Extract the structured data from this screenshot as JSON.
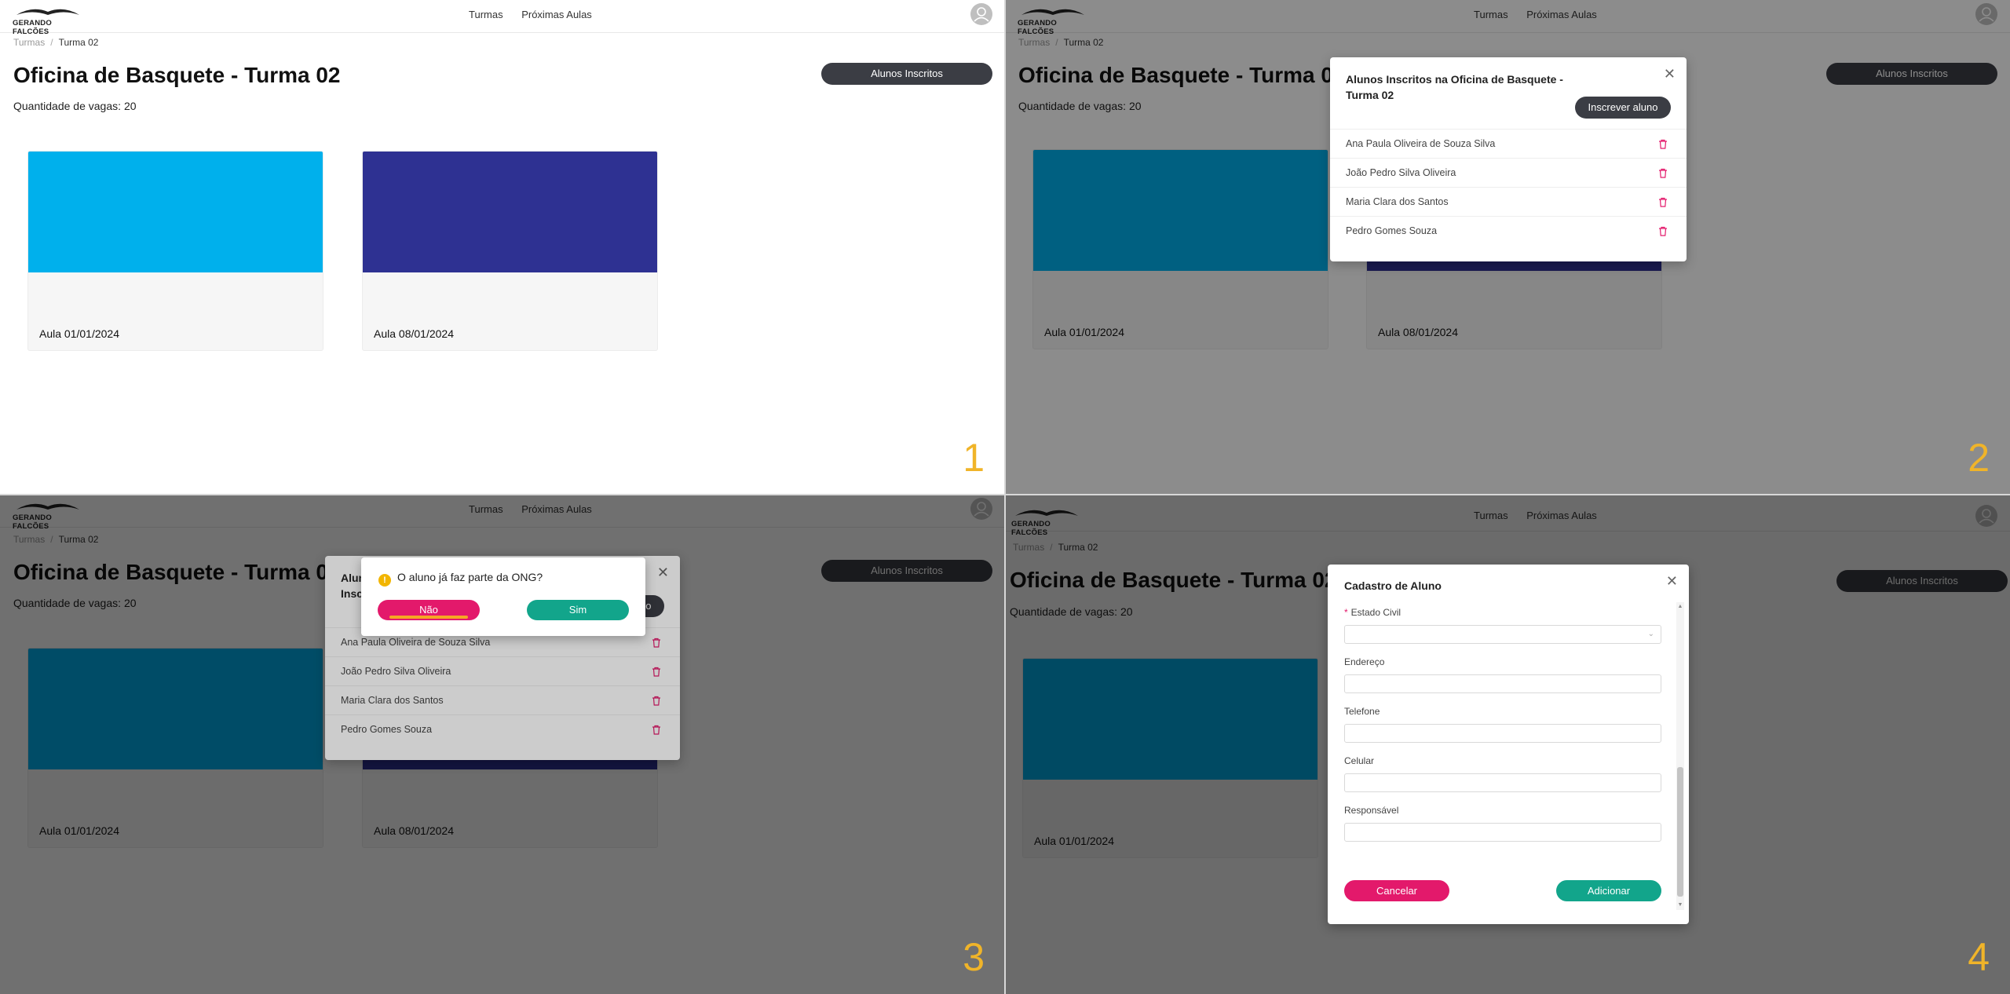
{
  "logo": {
    "text": "GERANDO FALCÕES"
  },
  "nav": {
    "items": [
      "Turmas",
      "Próximas Aulas"
    ]
  },
  "breadcrumb": {
    "root": "Turmas",
    "separator": "/",
    "current": "Turma 02"
  },
  "page": {
    "title": "Oficina de Basquete - Turma 02",
    "vagas_label": "Quantidade de vagas:",
    "vagas_value": "20"
  },
  "alunos_button": "Alunos Inscritos",
  "cards": [
    {
      "label": "Aula 01/01/2024",
      "color": "#00b0ec"
    },
    {
      "label": "Aula 08/01/2024",
      "color": "#2e3192"
    }
  ],
  "students_modal": {
    "title": "Alunos Inscritos na Oficina de Basquete - Turma 02",
    "title_partial": "Alunos Inscritos na Oficina de Basquete - Turma 02",
    "enroll_button": "Inscrever aluno",
    "students": [
      "Ana Paula Oliveira de Souza Silva",
      "João Pedro Silva Oliveira",
      "Maria Clara dos Santos",
      "Pedro Gomes Souza"
    ]
  },
  "confirm_dialog": {
    "question": "O aluno já faz parte da ONG?",
    "no": "Não",
    "yes": "Sim"
  },
  "register_modal": {
    "title": "Cadastro de Aluno",
    "fields": [
      "Estado Civil",
      "Endereço",
      "Telefone",
      "Celular",
      "Responsável"
    ],
    "cancel": "Cancelar",
    "add": "Adicionar"
  },
  "panel_numbers": [
    "1",
    "2",
    "3",
    "4"
  ],
  "colors": {
    "accent_pink": "#e3196b",
    "accent_green": "#12a58b",
    "dark_button": "#3b3d44",
    "warning": "#f2b500",
    "number": "#f0b429"
  }
}
